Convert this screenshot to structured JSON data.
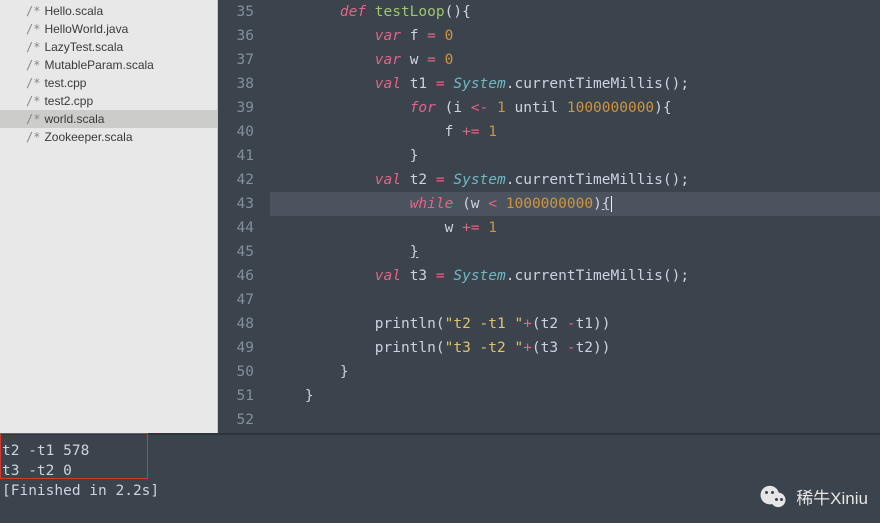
{
  "sidebar": {
    "files": [
      {
        "mod": "/*",
        "name": "Hello.scala",
        "selected": false
      },
      {
        "mod": "/*",
        "name": "HelloWorld.java",
        "selected": false
      },
      {
        "mod": "/*",
        "name": "LazyTest.scala",
        "selected": false
      },
      {
        "mod": "/*",
        "name": "MutableParam.scala",
        "selected": false
      },
      {
        "mod": "/*",
        "name": "test.cpp",
        "selected": false
      },
      {
        "mod": "/*",
        "name": "test2.cpp",
        "selected": false
      },
      {
        "mod": "/*",
        "name": "world.scala",
        "selected": true
      },
      {
        "mod": "/*",
        "name": "Zookeeper.scala",
        "selected": false
      }
    ]
  },
  "editor": {
    "first_line": 35,
    "highlight_line": 43,
    "lines": [
      {
        "n": 35,
        "ind": 8,
        "seg": [
          [
            "k-def",
            "def "
          ],
          [
            "fn",
            "testLoop"
          ],
          [
            "pun",
            "(){"
          ]
        ]
      },
      {
        "n": 36,
        "ind": 12,
        "seg": [
          [
            "k-var",
            "var "
          ],
          [
            "pun",
            "f "
          ],
          [
            "op",
            "="
          ],
          [
            "pun",
            " "
          ],
          [
            "num",
            "0"
          ]
        ]
      },
      {
        "n": 37,
        "ind": 12,
        "seg": [
          [
            "k-var",
            "var "
          ],
          [
            "pun",
            "w "
          ],
          [
            "op",
            "="
          ],
          [
            "pun",
            " "
          ],
          [
            "num",
            "0"
          ]
        ]
      },
      {
        "n": 38,
        "ind": 12,
        "seg": [
          [
            "k-var",
            "val "
          ],
          [
            "pun",
            "t1 "
          ],
          [
            "op",
            "="
          ],
          [
            "pun",
            " "
          ],
          [
            "type",
            "System"
          ],
          [
            "pun",
            ".currentTimeMillis();"
          ]
        ]
      },
      {
        "n": 39,
        "ind": 16,
        "seg": [
          [
            "k-for",
            "for "
          ],
          [
            "pun",
            "(i "
          ],
          [
            "op",
            "<-"
          ],
          [
            "pun",
            " "
          ],
          [
            "num",
            "1"
          ],
          [
            "pun",
            " until "
          ],
          [
            "num",
            "1000000000"
          ],
          [
            "pun",
            "){"
          ]
        ]
      },
      {
        "n": 40,
        "ind": 20,
        "seg": [
          [
            "pun",
            "f "
          ],
          [
            "op",
            "+="
          ],
          [
            "pun",
            " "
          ],
          [
            "num",
            "1"
          ]
        ]
      },
      {
        "n": 41,
        "ind": 16,
        "seg": [
          [
            "pun",
            "}"
          ]
        ]
      },
      {
        "n": 42,
        "ind": 12,
        "seg": [
          [
            "k-var",
            "val "
          ],
          [
            "pun",
            "t2 "
          ],
          [
            "op",
            "="
          ],
          [
            "pun",
            " "
          ],
          [
            "type",
            "System"
          ],
          [
            "pun",
            ".currentTimeMillis();"
          ]
        ]
      },
      {
        "n": 43,
        "ind": 16,
        "seg": [
          [
            "k-for",
            "while "
          ],
          [
            "pun",
            "(w "
          ],
          [
            "op",
            "<"
          ],
          [
            "pun",
            " "
          ],
          [
            "num",
            "1000000000"
          ],
          [
            "pun",
            ")"
          ],
          [
            "pun bracket-a",
            "{"
          ]
        ]
      },
      {
        "n": 44,
        "ind": 20,
        "seg": [
          [
            "pun",
            "w "
          ],
          [
            "op",
            "+="
          ],
          [
            "pun",
            " "
          ],
          [
            "num",
            "1"
          ]
        ]
      },
      {
        "n": 45,
        "ind": 16,
        "seg": [
          [
            "pun bracket-a",
            "}"
          ]
        ]
      },
      {
        "n": 46,
        "ind": 12,
        "seg": [
          [
            "k-var",
            "val "
          ],
          [
            "pun",
            "t3 "
          ],
          [
            "op",
            "="
          ],
          [
            "pun",
            " "
          ],
          [
            "type",
            "System"
          ],
          [
            "pun",
            ".currentTimeMillis();"
          ]
        ]
      },
      {
        "n": 47,
        "ind": 0,
        "seg": []
      },
      {
        "n": 48,
        "ind": 12,
        "seg": [
          [
            "pun",
            "println("
          ],
          [
            "str",
            "\"t2 -t1 \""
          ],
          [
            "op",
            "+"
          ],
          [
            "pun",
            "(t2 "
          ],
          [
            "op",
            "-"
          ],
          [
            "pun",
            "t1))"
          ]
        ]
      },
      {
        "n": 49,
        "ind": 12,
        "seg": [
          [
            "pun",
            "println("
          ],
          [
            "str",
            "\"t3 -t2 \""
          ],
          [
            "op",
            "+"
          ],
          [
            "pun",
            "(t3 "
          ],
          [
            "op",
            "-"
          ],
          [
            "pun",
            "t2))"
          ]
        ]
      },
      {
        "n": 50,
        "ind": 8,
        "seg": [
          [
            "pun",
            "}"
          ]
        ]
      },
      {
        "n": 51,
        "ind": 4,
        "seg": [
          [
            "pun",
            "}"
          ]
        ]
      },
      {
        "n": 52,
        "ind": 0,
        "seg": []
      }
    ]
  },
  "console": {
    "lines": [
      "t2 -t1 578",
      "t3 -t2 0",
      "[Finished in 2.2s]"
    ]
  },
  "watermark": {
    "text": "稀牛Xiniu"
  }
}
